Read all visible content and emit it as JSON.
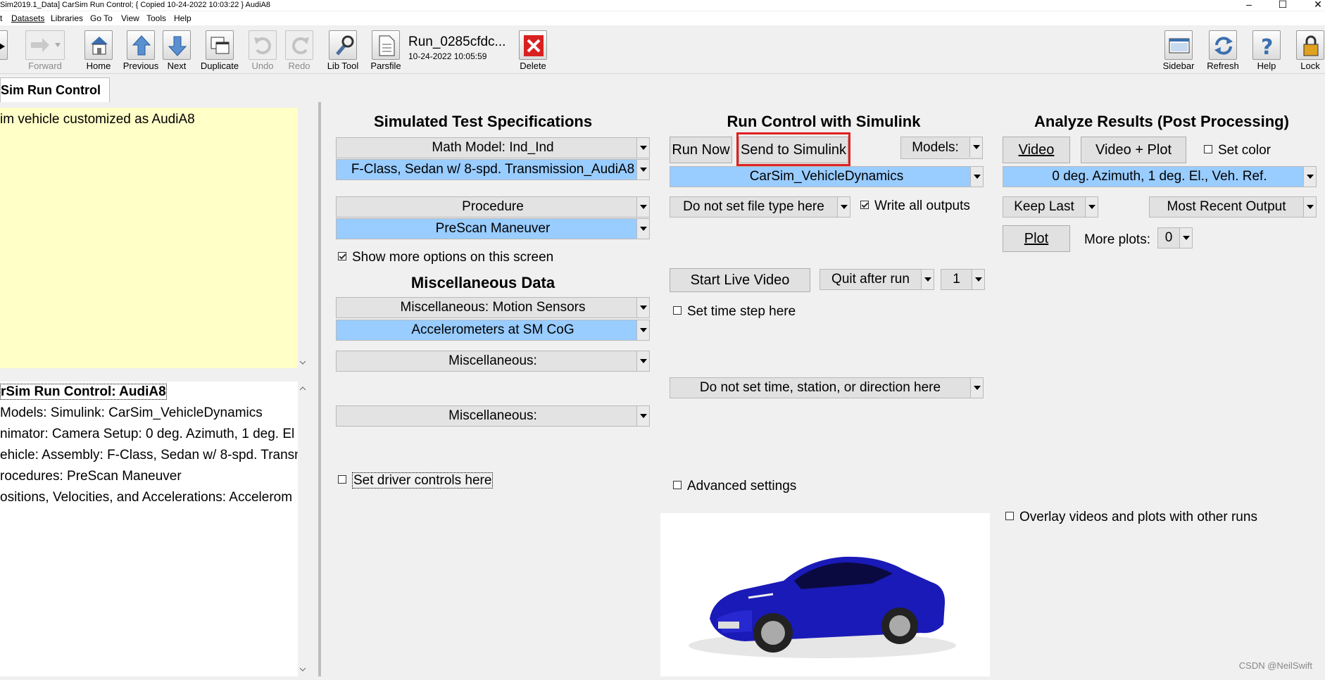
{
  "window": {
    "title": "Sim2019.1_Data] CarSim Run Control; { Copied 10-24-2022 10:03:22 } AudiA8"
  },
  "menu": [
    "t",
    "Datasets",
    "Libraries",
    "Go To",
    "View",
    "Tools",
    "Help"
  ],
  "toolbar": {
    "back_label": "k",
    "forward_label": "Forward",
    "home_label": "Home",
    "previous_label": "Previous",
    "next_label": "Next",
    "duplicate_label": "Duplicate",
    "undo_label": "Undo",
    "redo_label": "Redo",
    "libtool_label": "Lib Tool",
    "parsfile_label": "Parsfile",
    "run_name": "Run_0285cfdc...",
    "run_date": "10-24-2022 10:05:59",
    "delete_label": "Delete",
    "sidebar_label": "Sidebar",
    "refresh_label": "Refresh",
    "help_label": "Help",
    "lock_label": "Lock"
  },
  "tab": {
    "label": "Sim Run Control"
  },
  "left": {
    "notes": "im vehicle customized as AudiA8",
    "summary": [
      "rSim Run Control: AudiA8",
      "Models: Simulink: CarSim_VehicleDynamics",
      "nimator: Camera Setup: 0 deg. Azimuth, 1 deg. El",
      "ehicle: Assembly: F-Class, Sedan w/ 8-spd. Transn",
      "rocedures: PreScan Maneuver",
      "ositions, Velocities, and Accelerations: Accelerom"
    ]
  },
  "spec": {
    "heading": "Simulated Test Specifications",
    "math_model": "Math Model: Ind_Ind",
    "vehicle": "F-Class, Sedan w/ 8-spd. Transmission_AudiA8",
    "procedure": "Procedure",
    "procedure_value": "PreScan Maneuver",
    "show_more": "Show more options on this screen",
    "misc_heading": "Miscellaneous Data",
    "misc1": "Miscellaneous: Motion Sensors",
    "misc1_value": "Accelerometers at SM CoG",
    "misc2": "Miscellaneous:",
    "misc3": "Miscellaneous:",
    "driver_controls": "Set driver controls here"
  },
  "run": {
    "heading": "Run Control with Simulink",
    "run_now": "Run Now",
    "send": "Send to Simulink",
    "models": "Models:",
    "model_value": "CarSim_VehicleDynamics",
    "file_type": "Do not set file type here",
    "write_all": "Write all outputs",
    "live_video": "Start Live Video",
    "quit": "Quit after run",
    "quit_count": "1",
    "time_step": "Set time step here",
    "time_station": "Do not set time, station, or direction here",
    "advanced": "Advanced settings"
  },
  "analyze": {
    "heading": "Analyze Results (Post Processing)",
    "video": "Video",
    "video_plot": "Video + Plot",
    "set_color": "Set color",
    "camera": "0 deg. Azimuth, 1 deg. El., Veh. Ref.",
    "keep_last": "Keep Last",
    "recent": "Most Recent Output",
    "plot": "Plot",
    "more_plots": "More plots:",
    "more_plots_value": "0",
    "overlay": "Overlay videos and plots with other runs"
  },
  "watermark": "CSDN @NeilSwift"
}
